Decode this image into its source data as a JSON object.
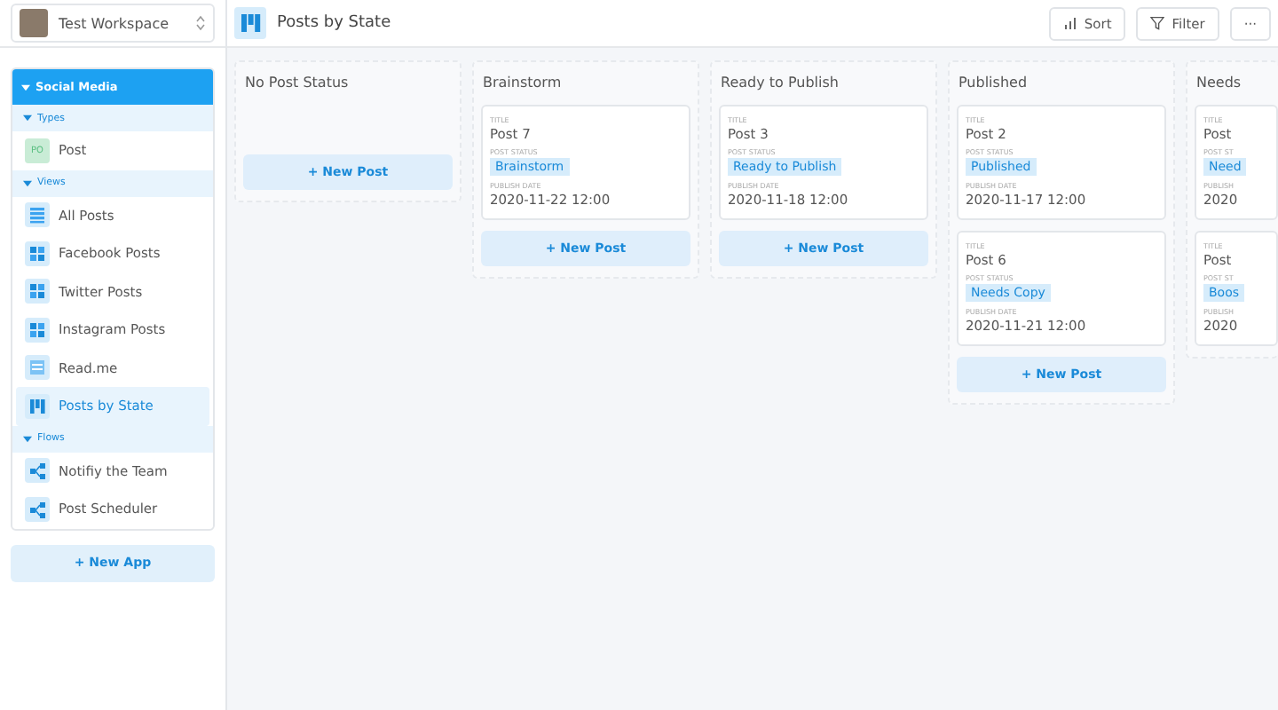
{
  "workspace": {
    "name": "Test Workspace"
  },
  "sidebar": {
    "title": "Social Media",
    "expanded": true,
    "sections": [
      {
        "label": "Types",
        "expanded": true,
        "items": [
          {
            "kind": "type",
            "badge": "PO",
            "label": "Post",
            "selected": false
          }
        ]
      },
      {
        "label": "Views",
        "expanded": true,
        "items": [
          {
            "kind": "table",
            "label": "All Posts",
            "selected": false
          },
          {
            "kind": "gallery",
            "label": "Facebook Posts",
            "selected": false
          },
          {
            "kind": "gallery",
            "label": "Twitter Posts",
            "selected": false
          },
          {
            "kind": "gallery",
            "label": "Instagram Posts",
            "selected": false
          },
          {
            "kind": "doc",
            "label": "Read.me",
            "selected": false
          },
          {
            "kind": "board",
            "label": "Posts by State",
            "selected": true
          }
        ]
      },
      {
        "label": "Flows",
        "expanded": true,
        "items": [
          {
            "kind": "flow",
            "label": "Notifiy the Team",
            "selected": false
          },
          {
            "kind": "flow",
            "label": "Post Scheduler",
            "selected": false
          }
        ]
      }
    ],
    "new_button": "+ New App"
  },
  "header": {
    "title": "Posts by State",
    "buttons": [
      {
        "kind": "sort",
        "label": "Sort"
      },
      {
        "kind": "filter",
        "label": "Filter"
      },
      {
        "kind": "more",
        "label": "···"
      }
    ]
  },
  "board": {
    "columns": [
      {
        "title": "No Post Status",
        "new_button": "+ New Post"
      },
      {
        "title": "Brainstorm",
        "cards": [
          {
            "title_label": "TITLE",
            "title": "Post 7",
            "status_label": "POST STATUS",
            "status": "Brainstorm",
            "date_label": "PUBLISH DATE",
            "date": "2020-11-22 12:00"
          }
        ],
        "new_button": "+ New Post"
      },
      {
        "title": "Ready to Publish",
        "cards": [
          {
            "title_label": "TITLE",
            "title": "Post 3",
            "status_label": "POST STATUS",
            "status": "Ready to Publish",
            "date_label": "PUBLISH DATE",
            "date": "2020-11-18 12:00"
          }
        ],
        "new_button": "+ New Post"
      },
      {
        "title": "Published",
        "cards": [
          {
            "title_label": "TITLE",
            "title": "Post 2",
            "status_label": "POST STATUS",
            "status": "Published",
            "date_label": "PUBLISH DATE",
            "date": "2020-11-17 12:00"
          },
          {
            "title_label": "TITLE",
            "title": "Post 6",
            "status_label": "POST STATUS",
            "status": "Needs Copy",
            "date_label": "PUBLISH DATE",
            "date": "2020-11-21 12:00"
          }
        ],
        "new_button": "+ New Post"
      },
      {
        "title": "Needs",
        "cards": [
          {
            "title_label": "TITLE",
            "title": "Post",
            "status_label": "POST ST",
            "status": "Need",
            "date_label": "PUBLISH",
            "date": "2020"
          },
          {
            "title_label": "TITLE",
            "title": "Post",
            "status_label": "POST ST",
            "status": "Boos",
            "date_label": "PUBLISH",
            "date": "2020"
          }
        ]
      }
    ]
  }
}
